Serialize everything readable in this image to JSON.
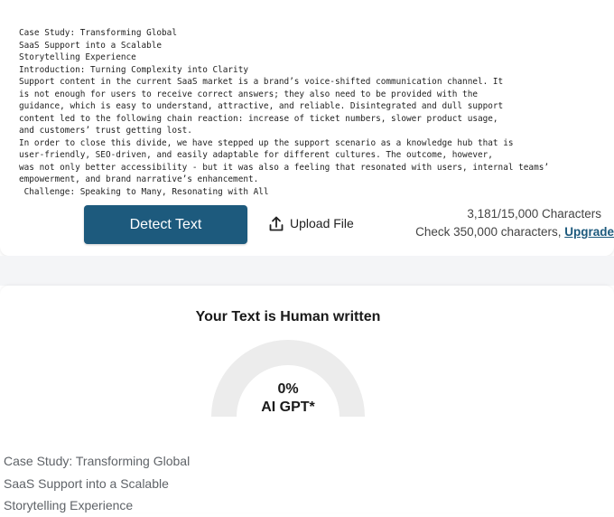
{
  "editor": {
    "text_lines": [
      "Case Study: Transforming Global",
      "SaaS Support into a Scalable",
      "Storytelling Experience",
      "Introduction: Turning Complexity into Clarity",
      "Support content in the current SaaS market is a brand’s voice-shifted communication channel. It",
      "is not enough for users to receive correct answers; they also need to be provided with the",
      "guidance, which is easy to understand, attractive, and reliable. Disintegrated and dull support",
      "content led to the following chain reaction: increase of ticket numbers, slower product usage,",
      "and customers’ trust getting lost.",
      "In order to close this divide, we have stepped up the support scenario as a knowledge hub that is",
      "user-friendly, SEO-driven, and easily adaptable for different cultures. The outcome, however,",
      "was not only better accessibility - but it was also a feeling that resonated with users, internal teams’",
      "empowerment, and brand narrative’s enhancement.",
      " Challenge: Speaking to Many, Resonating with All"
    ]
  },
  "actions": {
    "detect_label": "Detect Text",
    "upload_label": "Upload File",
    "upload_icon": "upload-icon"
  },
  "counter": {
    "characters": "3,181/15,000 Characters",
    "check_prefix": "Check 350,000 characters, ",
    "upgrade_label": "Upgrade"
  },
  "result": {
    "title": "Your Text is Human written",
    "percent_text": "0%",
    "percent_value": 0,
    "model_label": "AI GPT*"
  },
  "preview": {
    "lines": [
      "Case Study: Transforming Global",
      "SaaS Support into a Scalable",
      "Storytelling Experience"
    ]
  },
  "colors": {
    "primary_button": "#1d5a7d",
    "gauge_track": "#ececec",
    "gauge_fill": "#1d5a7d"
  }
}
